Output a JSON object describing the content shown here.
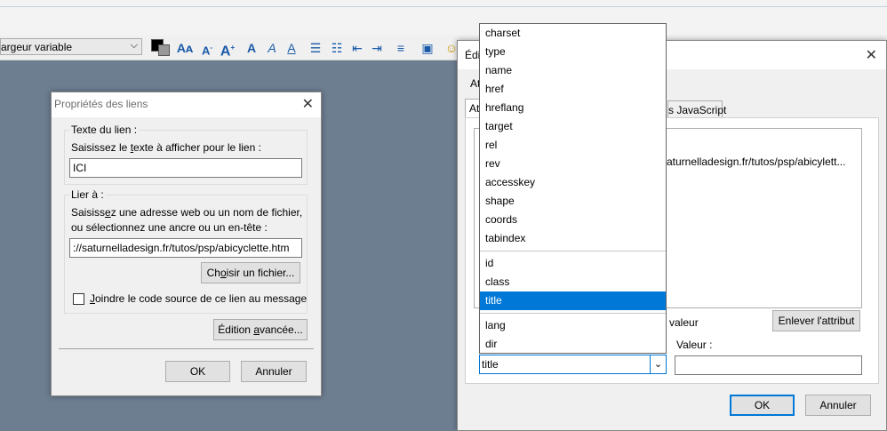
{
  "toolbar": {
    "font_value": "argeur variable",
    "font_dropdown_arrow": "⌵"
  },
  "link_dialog": {
    "title": "Propriétés des liens",
    "link_text_group": "Texte du lien :",
    "link_text_instruction_pre": "Saisissez le ",
    "link_text_instruction_u": "t",
    "link_text_instruction_post": "exte à afficher pour le lien :",
    "link_text_value": "ICI",
    "link_to_group": "Lier à :",
    "link_to_instruction_line1_pre": "Saisiss",
    "link_to_instruction_line1_u": "e",
    "link_to_instruction_line1_post": "z une adresse web ou un nom de fichier,",
    "link_to_instruction_line2": "ou sélectionnez une ancre ou un en-tête :",
    "link_to_value": "://saturnelladesign.fr/tutos/psp/abicyclette.htm",
    "choose_file_pre": "Ch",
    "choose_file_u": "o",
    "choose_file_post": "isir un fichier...",
    "attach_source_u": "J",
    "attach_source_post": "oindre le code source de ce lien au message",
    "advanced_pre": "Édition ",
    "advanced_u": "a",
    "advanced_post": "vancée...",
    "ok_label": "OK",
    "cancel_label": "Annuler"
  },
  "advanced_dialog": {
    "title_fragment": "Édi",
    "attr_fragment": "At",
    "tab_fragment": "At",
    "js_tab_fragment": "s JavaScript",
    "attr_value_display": "aturnelladesign.fr/tutos/psp/abicylett...",
    "value_label_fragment": "valeur",
    "remove_attr_label": "Enlever l'attribut",
    "value_label": "Valeur :",
    "ok_label": "OK",
    "cancel_label": "Annuler"
  },
  "attribute_dropdown": {
    "options_group1": [
      "charset",
      "type",
      "name",
      "href",
      "hreflang",
      "target",
      "rel",
      "rev",
      "accesskey",
      "shape",
      "coords",
      "tabindex"
    ],
    "options_group2": [
      "id",
      "class",
      "title"
    ],
    "options_group3": [
      "lang",
      "dir"
    ],
    "selected": "title",
    "combo_value": "title"
  }
}
